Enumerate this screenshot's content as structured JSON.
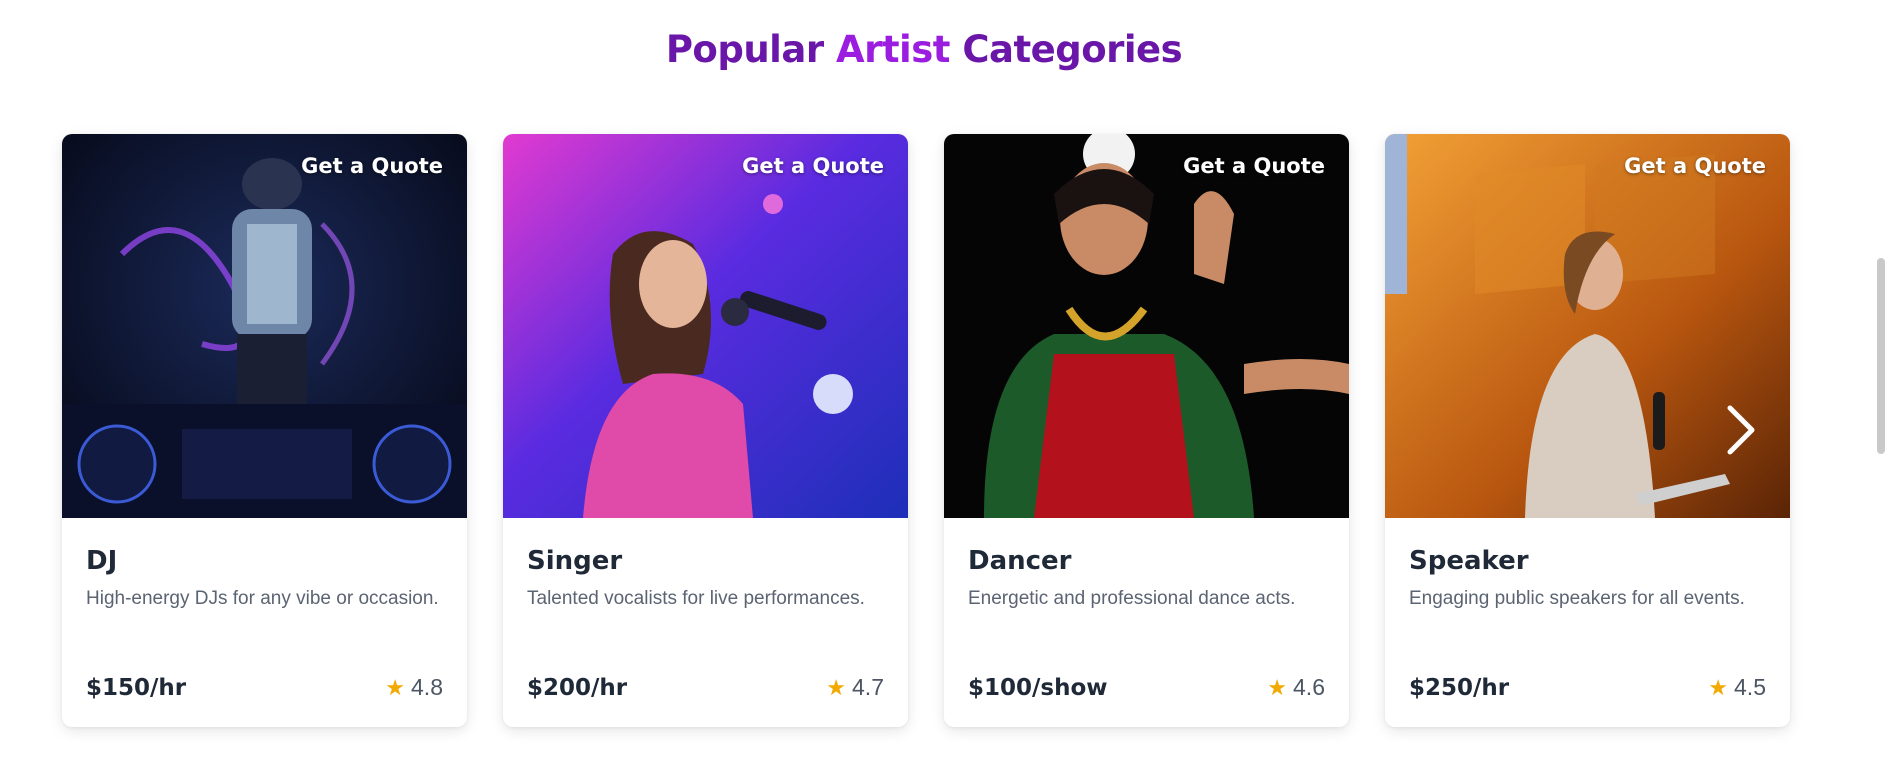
{
  "heading": {
    "part1": "Popular ",
    "accent": "Artist",
    "part2": " Categories"
  },
  "quote_label": "Get a Quote",
  "cards": [
    {
      "title": "DJ",
      "description": "High-energy DJs for any vibe or occasion.",
      "price": "$150/hr",
      "rating": "4.8"
    },
    {
      "title": "Singer",
      "description": "Talented vocalists for live performances.",
      "price": "$200/hr",
      "rating": "4.7"
    },
    {
      "title": "Dancer",
      "description": "Energetic and professional dance acts.",
      "price": "$100/show",
      "rating": "4.6"
    },
    {
      "title": "Speaker",
      "description": "Engaging public speakers for all events.",
      "price": "$250/hr",
      "rating": "4.5"
    }
  ],
  "icons": {
    "rating": "star-icon",
    "carousel_next": "chevron-right-icon"
  },
  "colors": {
    "heading": "#6a16a8",
    "accent": "#9b1ee0",
    "star": "#f2a900",
    "text_dark": "#1f2937",
    "text_muted": "#5b6472"
  }
}
